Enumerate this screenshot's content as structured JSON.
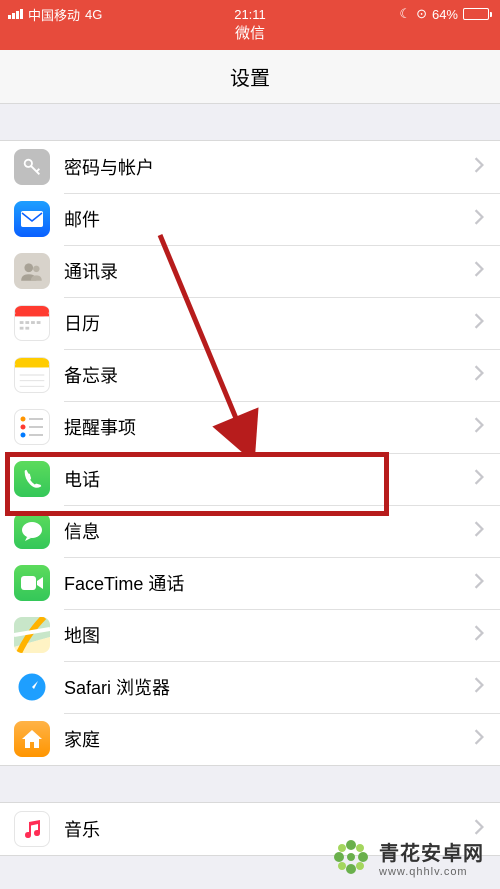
{
  "status": {
    "carrier": "中国移动",
    "network": "4G",
    "time": "21:11",
    "battery_pct": "64%",
    "battery_fill": 64
  },
  "nav": {
    "title": "微信"
  },
  "page": {
    "title": "设置"
  },
  "rows": {
    "passwords": "密码与帐户",
    "mail": "邮件",
    "contacts": "通讯录",
    "calendar": "日历",
    "notes": "备忘录",
    "reminders": "提醒事项",
    "phone": "电话",
    "messages": "信息",
    "facetime": "FaceTime 通话",
    "maps": "地图",
    "safari": "Safari 浏览器",
    "home": "家庭",
    "music": "音乐"
  },
  "watermark": {
    "title": "青花安卓网",
    "url": "www.qhhlv.com"
  },
  "colors": {
    "header": "#e74b3c",
    "highlight": "#b71c1c"
  }
}
